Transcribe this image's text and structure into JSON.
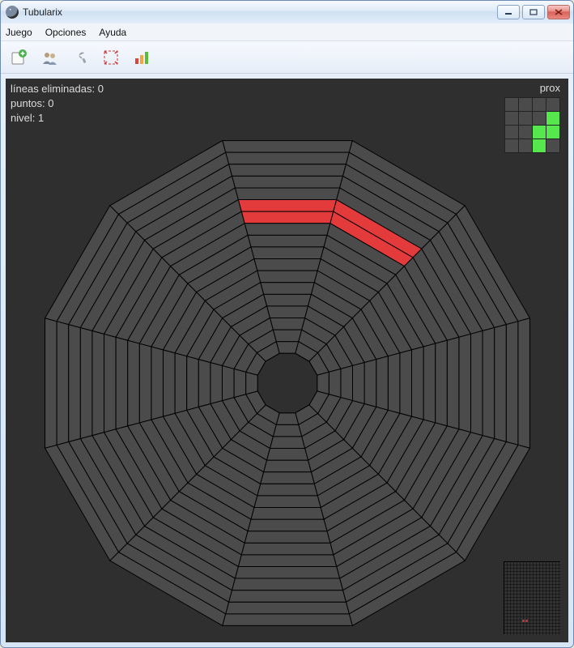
{
  "window": {
    "title": "Tubularix"
  },
  "menu": {
    "juego": "Juego",
    "opciones": "Opciones",
    "ayuda": "Ayuda"
  },
  "toolbar_icons": {
    "new": "new-game-icon",
    "players": "players-icon",
    "settings": "settings-icon",
    "resize": "resize-icon",
    "stats": "stats-icon"
  },
  "stats": {
    "lines_label": "líneas eliminadas:",
    "lines_value": "0",
    "points_label": "puntos:",
    "points_value": "0",
    "level_label": "nivel:",
    "level_value": "1"
  },
  "next": {
    "label": "prox",
    "piece_name": "S-piece",
    "piece_color": "#56e64e",
    "grid": [
      [
        0,
        0,
        0,
        0
      ],
      [
        0,
        0,
        0,
        1
      ],
      [
        0,
        0,
        1,
        1
      ],
      [
        0,
        0,
        1,
        0
      ]
    ]
  },
  "board": {
    "sectors": 12,
    "rings": 18,
    "sector_fill": "#4b4b4b",
    "sector_stroke": "#000000",
    "center_fill": "#2f2f2f",
    "active_piece": {
      "color": "#e33b3b",
      "name": "square-piece",
      "cells": [
        {
          "sector": 0,
          "ring": 5
        },
        {
          "sector": 0,
          "ring": 6
        },
        {
          "sector": 1,
          "ring": 5
        },
        {
          "sector": 1,
          "ring": 6
        }
      ]
    }
  },
  "colors": {
    "game_bg": "#2f2f2f",
    "text": "#dcdcdc"
  }
}
